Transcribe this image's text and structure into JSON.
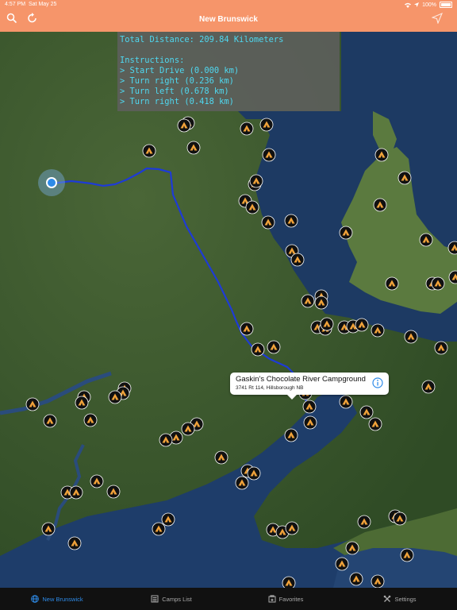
{
  "status_bar": {
    "time": "4:57 PM",
    "date": "Sat May 25",
    "battery": "100%"
  },
  "nav": {
    "title": "New Brunswick"
  },
  "instructions": {
    "total": "Total Distance: 209.84 Kilometers",
    "heading": "Instructions:",
    "steps": [
      "> Start Drive (0.000 km)",
      "> Turn right (0.236 km)",
      "> Turn left (0.678 km)",
      "> Turn right (0.418 km)"
    ]
  },
  "callout": {
    "title": "Gaskin's Chocolate River Campground",
    "subtitle": "3741 Rt 114, Hillsborough NB"
  },
  "tabs": [
    {
      "label": "New Brunswick",
      "icon": "globe-icon",
      "active": true
    },
    {
      "label": "Camps List",
      "icon": "list-icon",
      "active": false
    },
    {
      "label": "Favorites",
      "icon": "favorites-icon",
      "active": false
    },
    {
      "label": "Settings",
      "icon": "settings-icon",
      "active": false
    }
  ],
  "colors": {
    "nav_bar": "#F6956A",
    "route": "#1E3BD6",
    "tab_active": "#2E8BE8",
    "instruction_text": "#4FD8F0",
    "marker": "#111111",
    "tent": "#F2A33A"
  }
}
